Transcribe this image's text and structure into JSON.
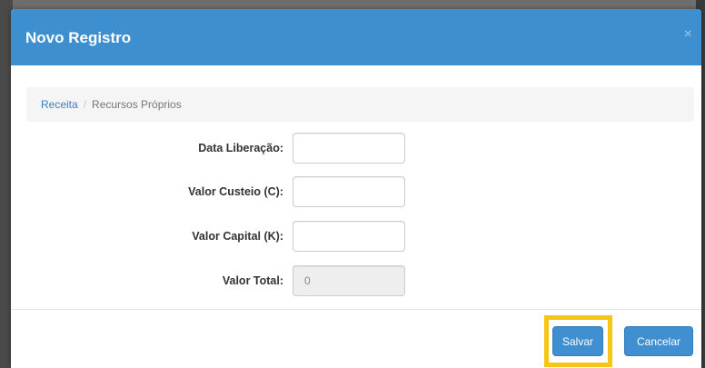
{
  "modal": {
    "title": "Novo Registro",
    "close_symbol": "×"
  },
  "breadcrumb": {
    "items": [
      "Receita",
      "Recursos Próprios"
    ],
    "separator": "/"
  },
  "form": {
    "fields": [
      {
        "label": "Data Liberação:",
        "value": "",
        "readonly": false
      },
      {
        "label": "Valor Custeio (C):",
        "value": "",
        "readonly": false
      },
      {
        "label": "Valor Capital (K):",
        "value": "",
        "readonly": false
      },
      {
        "label": "Valor Total:",
        "value": "0",
        "readonly": true
      }
    ]
  },
  "footer": {
    "save_label": "Salvar",
    "cancel_label": "Cancelar"
  },
  "colors": {
    "header": "#3e8fd0",
    "button": "#3f8fd1",
    "highlight": "#f5c518"
  }
}
